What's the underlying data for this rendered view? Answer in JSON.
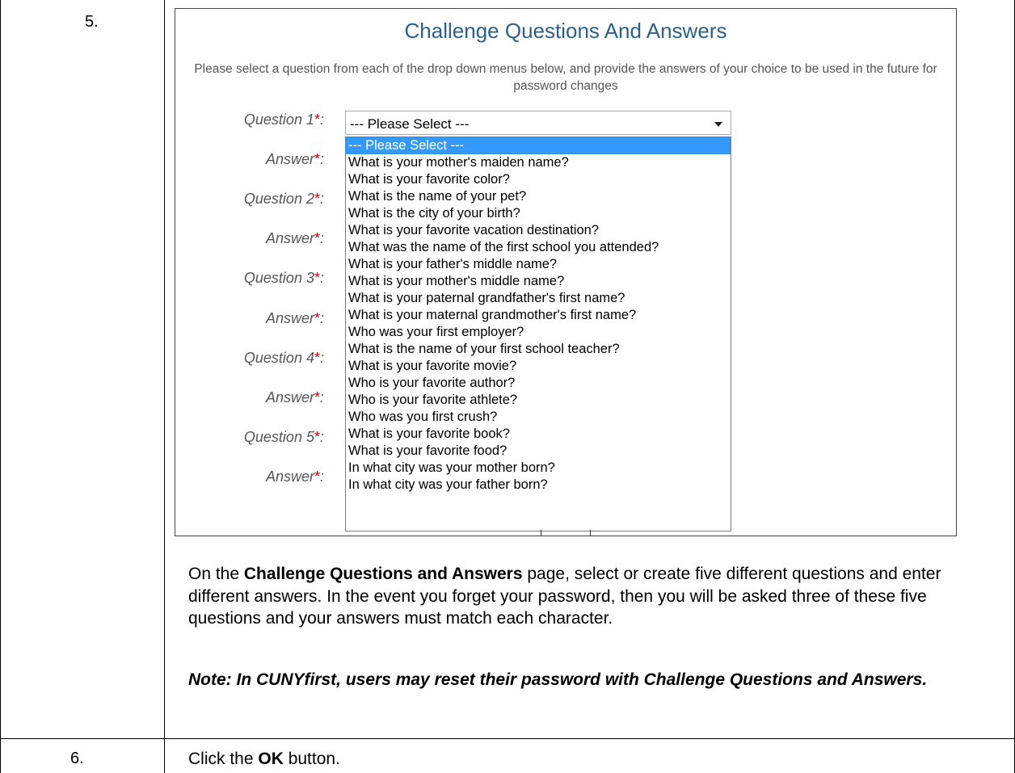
{
  "steps": [
    {
      "number": "5."
    },
    {
      "number": "6."
    }
  ],
  "screenshot": {
    "title": "Challenge Questions And Answers",
    "intro": "Please select a question from each of the drop down menus below, and provide the answers of your choice to be used in the future for password changes",
    "required_mark": "*",
    "labels": [
      "Question 1",
      "Answer",
      "Question 2",
      "Answer",
      "Question 3",
      "Answer",
      "Question 4",
      "Answer",
      "Question 5",
      "Answer"
    ],
    "select": {
      "value": "--- Please Select ---"
    },
    "options": [
      "--- Please Select ---",
      "What is your mother's maiden name?",
      "What is your favorite color?",
      "What is the name of your pet?",
      "What is the city of your birth?",
      "What is your favorite vacation destination?",
      "What was the name of the first school you attended?",
      "What is your father's middle name?",
      "What is your mother's middle name?",
      "What is your paternal grandfather's first name?",
      "What is your maternal grandmother's first name?",
      "Who was your first employer?",
      "What is the name of your first school teacher?",
      "What is your favorite movie?",
      "Who is your favorite author?",
      "Who is your favorite athlete?",
      "Who was you first crush?",
      "What is your favorite book?",
      "What is your favorite food?",
      "In what city was your mother born?",
      "In what city was your father born?"
    ],
    "highlight_color": "#3399ff",
    "title_color": "#2c5f8a",
    "required_color": "#d40000"
  },
  "instructions": {
    "p1_pre": "On the ",
    "p1_bold": "Challenge Questions and Answers",
    "p1_post": " page, select or create five different questions and enter different answers.  In the event you forget your password, then you will be asked three of these five questions and your answers must match each character.",
    "note": "Note:  In CUNYfirst, users may reset their password with Challenge Questions and Answers.",
    "step6_pre": "Click the ",
    "step6_bold": "OK",
    "step6_post": " button."
  }
}
